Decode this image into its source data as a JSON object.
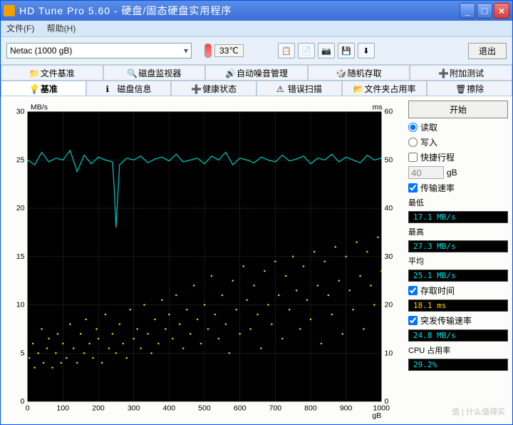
{
  "window": {
    "title": "HD Tune Pro 5.60 - 硬盘/固态硬盘实用程序"
  },
  "menu": {
    "file": "文件(F)",
    "help": "帮助(H)"
  },
  "toolbar": {
    "drive": "Netac          (1000 gB)",
    "temperature": "33℃",
    "exit": "退出"
  },
  "tabs_row1": {
    "file_bench": "文件基准",
    "disk_monitor": "磁盘监视器",
    "auto_noise": "自动噪音管理",
    "random_access": "随机存取",
    "extra_tests": "附加测试"
  },
  "tabs_row2": {
    "benchmark": "基准",
    "disk_info": "磁盘信息",
    "health": "健康状态",
    "error_scan": "错误扫描",
    "folder_usage": "文件夹占用率",
    "erase": "擦除"
  },
  "side": {
    "start": "开始",
    "read": "读取",
    "write": "写入",
    "short_stroke": "快捷行程",
    "short_stroke_val": "40",
    "short_stroke_unit": "gB",
    "transfer_rate": "传输速率",
    "min_label": "最低",
    "min_val": "17.1 MB/s",
    "max_label": "最高",
    "max_val": "27.3 MB/s",
    "avg_label": "平均",
    "avg_val": "25.1 MB/s",
    "access_time": "存取时间",
    "access_val": "18.1 ms",
    "burst_rate": "突发传输速率",
    "burst_val": "24.8 MB/s",
    "cpu_usage": "CPU 占用率",
    "cpu_val": "29.2%"
  },
  "chart_data": {
    "type": "line+scatter",
    "xlabel": "gB",
    "ylabel_left": "MB/s",
    "ylabel_right": "ms",
    "xlim": [
      0,
      1000
    ],
    "ylim_left": [
      0,
      30
    ],
    "ylim_right": [
      0,
      60
    ],
    "x_ticks": [
      0,
      100,
      200,
      300,
      400,
      500,
      600,
      700,
      800,
      900,
      1000
    ],
    "y_ticks_left": [
      0,
      5,
      10,
      15,
      20,
      25,
      30
    ],
    "y_ticks_right": [
      0,
      10,
      20,
      30,
      40,
      50,
      60
    ],
    "series": [
      {
        "name": "transfer_rate",
        "type": "line",
        "color": "#00c0c0",
        "x": [
          0,
          20,
          40,
          60,
          80,
          100,
          120,
          140,
          160,
          180,
          200,
          220,
          240,
          245,
          250,
          260,
          280,
          300,
          320,
          340,
          360,
          380,
          400,
          420,
          440,
          460,
          480,
          500,
          520,
          540,
          560,
          580,
          600,
          620,
          640,
          660,
          680,
          700,
          720,
          740,
          760,
          780,
          800,
          820,
          840,
          860,
          880,
          900,
          920,
          940,
          960,
          980,
          1000
        ],
        "y": [
          25,
          24.5,
          25.8,
          24.8,
          25.2,
          25,
          26,
          23.8,
          25.5,
          24.6,
          25.3,
          25,
          24.8,
          22,
          18,
          24.5,
          25.2,
          25,
          25.4,
          24.7,
          25.1,
          25.3,
          24.9,
          25.6,
          24.8,
          25,
          25.2,
          24.6,
          25.4,
          25,
          25.8,
          24.5,
          25.2,
          25,
          24.7,
          25.3,
          25,
          24.8,
          25.5,
          24.9,
          25.1,
          25.4,
          24.6,
          25.2,
          25,
          25.6,
          24.8,
          25.3,
          25,
          24.7,
          25.5,
          25,
          25.2
        ]
      },
      {
        "name": "access_time",
        "type": "scatter",
        "color": "#d8d800",
        "axis": "right",
        "x": [
          5,
          15,
          20,
          30,
          40,
          45,
          55,
          60,
          70,
          80,
          85,
          95,
          100,
          110,
          120,
          130,
          140,
          150,
          160,
          165,
          175,
          185,
          195,
          200,
          210,
          220,
          230,
          240,
          250,
          260,
          270,
          280,
          290,
          300,
          310,
          320,
          330,
          340,
          350,
          360,
          370,
          380,
          390,
          400,
          410,
          420,
          430,
          440,
          450,
          460,
          470,
          480,
          490,
          500,
          510,
          520,
          530,
          540,
          550,
          560,
          570,
          580,
          590,
          600,
          610,
          620,
          630,
          640,
          650,
          660,
          670,
          680,
          690,
          700,
          710,
          720,
          730,
          740,
          750,
          760,
          770,
          780,
          790,
          800,
          810,
          820,
          830,
          840,
          850,
          860,
          870,
          880,
          890,
          900,
          910,
          920,
          930,
          940,
          950,
          960,
          970,
          980,
          990,
          1000
        ],
        "y": [
          9,
          12,
          7,
          10,
          15,
          8,
          11,
          13,
          7,
          10,
          14,
          8,
          12,
          9,
          16,
          11,
          8,
          14,
          10,
          17,
          12,
          9,
          15,
          13,
          8,
          18,
          11,
          14,
          10,
          16,
          12,
          9,
          19,
          13,
          15,
          11,
          20,
          14,
          10,
          17,
          12,
          21,
          15,
          18,
          13,
          22,
          16,
          11,
          19,
          14,
          24,
          17,
          12,
          20,
          15,
          26,
          18,
          13,
          22,
          16,
          10,
          25,
          19,
          14,
          28,
          21,
          15,
          24,
          18,
          11,
          27,
          20,
          16,
          29,
          22,
          13,
          26,
          19,
          30,
          23,
          15,
          28,
          21,
          17,
          31,
          24,
          12,
          29,
          22,
          18,
          32,
          25,
          14,
          30,
          23,
          19,
          33,
          26,
          15,
          31,
          24,
          20,
          34,
          27
        ]
      }
    ]
  },
  "watermark": "值 | 什么值得买"
}
